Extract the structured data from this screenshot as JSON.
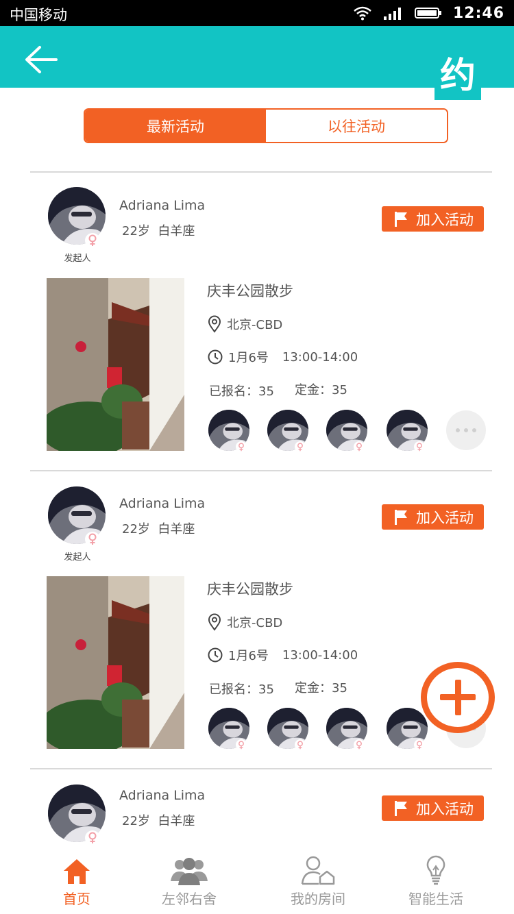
{
  "status_bar": {
    "carrier": "中国移动",
    "time": "12:46"
  },
  "header": {
    "logo": "约",
    "back_icon": "arrow-left-icon"
  },
  "tabs": [
    {
      "label": "最新活动",
      "active": true
    },
    {
      "label": "以往活动",
      "active": false
    }
  ],
  "cards": [
    {
      "user": {
        "name": "Adriana Lima",
        "age": "22岁",
        "sign": "白羊座",
        "role": "发起人",
        "gender": "female"
      },
      "join_label": "加入活动",
      "activity": {
        "title": "庆丰公园散步",
        "location": "北京-CBD",
        "date": "1月6号",
        "time": "13:00-14:00",
        "signed_up": "已报名：35",
        "deposit": "定金：35"
      }
    },
    {
      "user": {
        "name": "Adriana Lima",
        "age": "22岁",
        "sign": "白羊座",
        "role": "发起人",
        "gender": "female"
      },
      "join_label": "加入活动",
      "activity": {
        "title": "庆丰公园散步",
        "location": "北京-CBD",
        "date": "1月6号",
        "time": "13:00-14:00",
        "signed_up": "已报名：35",
        "deposit": "定金：35"
      }
    },
    {
      "user": {
        "name": "Adriana Lima",
        "age": "22岁",
        "sign": "白羊座",
        "gender": "female"
      },
      "join_label": "加入活动"
    }
  ],
  "bottom_nav": [
    {
      "label": "首页",
      "icon": "home-icon",
      "active": true
    },
    {
      "label": "左邻右舍",
      "icon": "people-icon",
      "active": false
    },
    {
      "label": "我的房间",
      "icon": "user-house-icon",
      "active": false
    },
    {
      "label": "智能生活",
      "icon": "lightbulb-icon",
      "active": false
    }
  ],
  "colors": {
    "accent": "#f26124",
    "header": "#12c4c4",
    "female": "#f3a0a8"
  }
}
